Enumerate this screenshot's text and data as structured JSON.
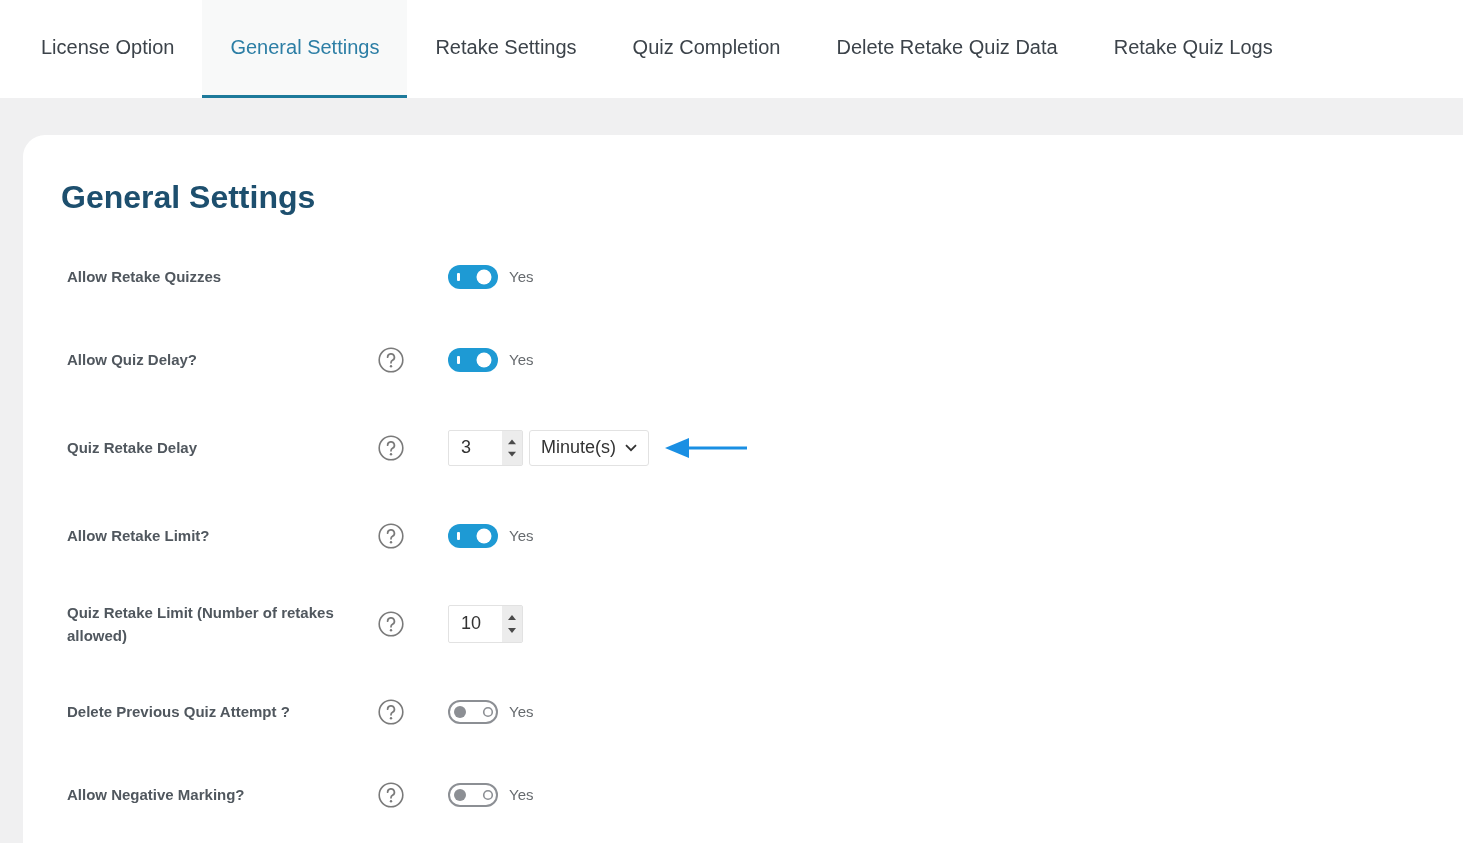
{
  "tabs": [
    {
      "label": "License Option",
      "selected": false
    },
    {
      "label": "General Settings",
      "selected": true
    },
    {
      "label": "Retake Settings",
      "selected": false
    },
    {
      "label": "Quiz Completion",
      "selected": false
    },
    {
      "label": "Delete Retake Quiz Data",
      "selected": false
    },
    {
      "label": "Retake Quiz Logs",
      "selected": false
    }
  ],
  "heading": "General Settings",
  "settings": [
    {
      "kind": "toggle",
      "label": "Allow Retake Quizzes",
      "help": false,
      "on": true,
      "toggle_label": "Yes",
      "pointed_at": false
    },
    {
      "kind": "toggle",
      "label": "Allow Quiz Delay?",
      "help": true,
      "on": true,
      "toggle_label": "Yes",
      "pointed_at": false
    },
    {
      "kind": "number_unit",
      "label": "Quiz Retake Delay",
      "help": true,
      "value": "3",
      "unit": "Minute(s)",
      "pointed_at": true
    },
    {
      "kind": "toggle",
      "label": "Allow Retake Limit?",
      "help": true,
      "on": true,
      "toggle_label": "Yes",
      "pointed_at": false
    },
    {
      "kind": "number",
      "label": "Quiz Retake Limit (Number of retakes allowed)",
      "help": true,
      "value": "10",
      "pointed_at": false
    },
    {
      "kind": "toggle",
      "label": "Delete Previous Quiz Attempt ?",
      "help": true,
      "on": false,
      "toggle_label": "Yes",
      "pointed_at": false
    },
    {
      "kind": "toggle",
      "label": "Allow Negative Marking?",
      "help": true,
      "on": false,
      "toggle_label": "Yes",
      "pointed_at": false
    }
  ]
}
